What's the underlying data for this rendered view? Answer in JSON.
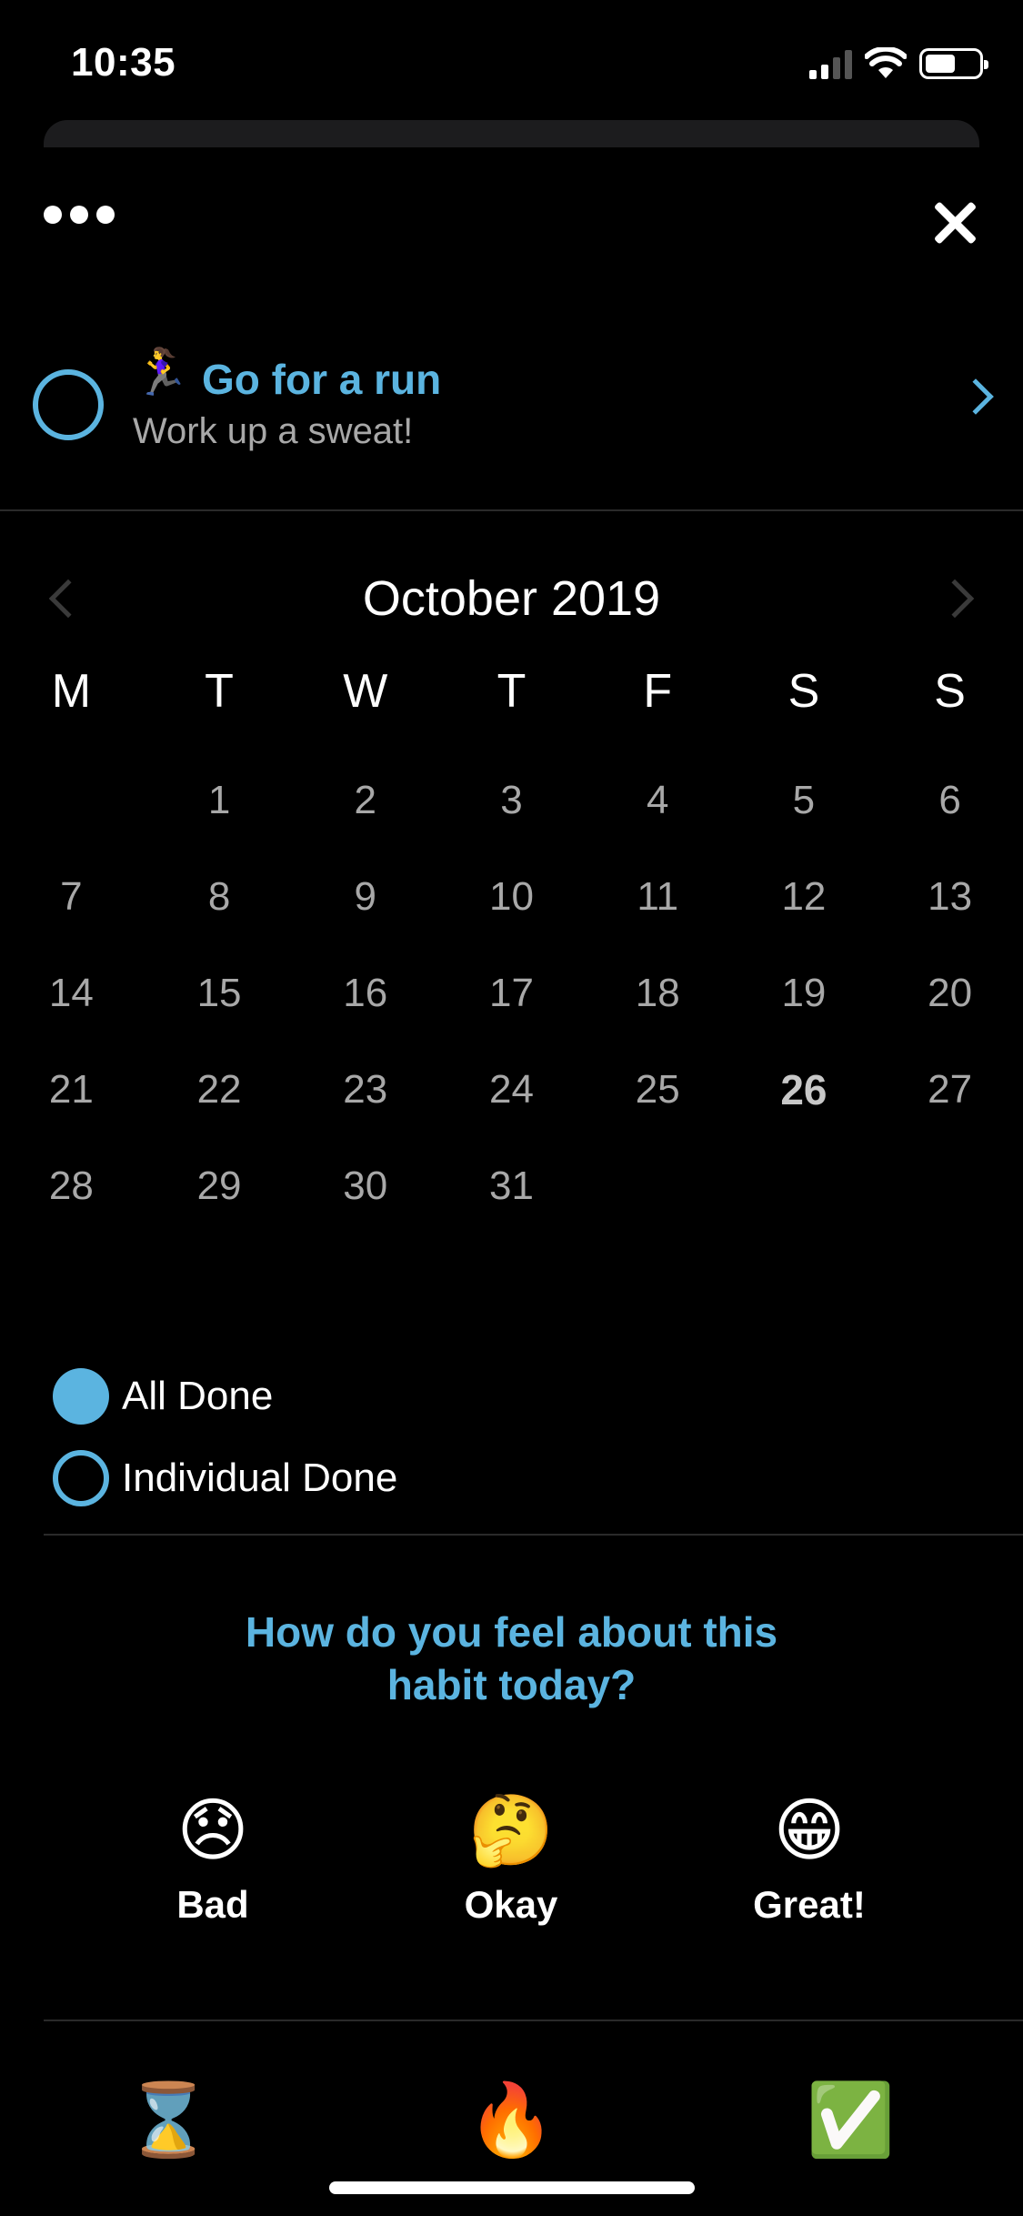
{
  "status_bar": {
    "time": "10:35"
  },
  "habit": {
    "emoji": "🏃‍♀️",
    "title": "Go for a run",
    "subtitle": "Work up a sweat!"
  },
  "calendar": {
    "month_title": "October 2019",
    "weekdays": [
      "M",
      "T",
      "W",
      "T",
      "F",
      "S",
      "S"
    ],
    "days": [
      "",
      "1",
      "2",
      "3",
      "4",
      "5",
      "6",
      "7",
      "8",
      "9",
      "10",
      "11",
      "12",
      "13",
      "14",
      "15",
      "16",
      "17",
      "18",
      "19",
      "20",
      "21",
      "22",
      "23",
      "24",
      "25",
      "26",
      "27",
      "28",
      "29",
      "30",
      "31",
      "",
      "",
      ""
    ],
    "today": "26"
  },
  "legend": {
    "all_done": "All Done",
    "individual_done": "Individual Done"
  },
  "feeling": {
    "question": "How do you feel about this habit today?",
    "moods": [
      {
        "emoji": "😞",
        "label": "Bad"
      },
      {
        "emoji": "🤔",
        "label": "Okay"
      },
      {
        "emoji": "😁",
        "label": "Great!"
      }
    ]
  },
  "tabs": [
    {
      "emoji": "⌛"
    },
    {
      "emoji": "🔥"
    },
    {
      "emoji": "✅"
    }
  ],
  "colors": {
    "accent": "#5bb4e0",
    "background": "#000000",
    "muted_text": "#a8a8a8"
  }
}
